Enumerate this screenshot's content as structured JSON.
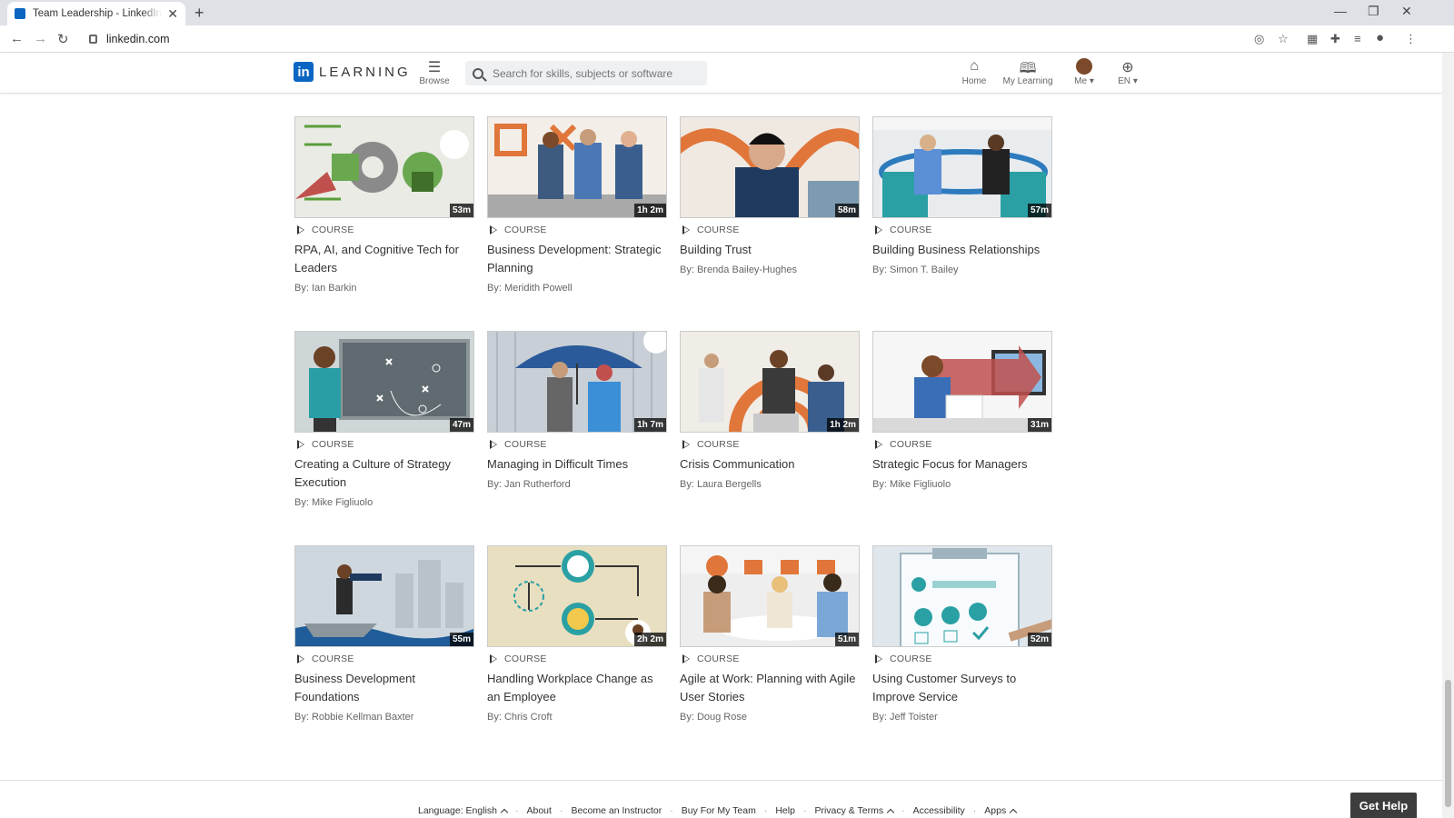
{
  "browser": {
    "tab_title": "Team Leadership - LinkedIn Learning",
    "url": "linkedin.com"
  },
  "header": {
    "logo_in": "in",
    "logo_word": "LEARNING",
    "browse": "Browse",
    "search_placeholder": "Search for skills, subjects or software",
    "nav": {
      "home": "Home",
      "my_learning": "My Learning",
      "me": "Me",
      "lang": "EN"
    }
  },
  "courses": [
    {
      "type": "COURSE",
      "title": "RPA, AI, and Cognitive Tech for Leaders",
      "author": "By: Ian Barkin",
      "duration": "53m"
    },
    {
      "type": "COURSE",
      "title": "Business Development: Strategic Planning",
      "author": "By: Meridith Powell",
      "duration": "1h 2m"
    },
    {
      "type": "COURSE",
      "title": "Building Trust",
      "author": "By: Brenda Bailey-Hughes",
      "duration": "58m"
    },
    {
      "type": "COURSE",
      "title": "Building Business Relationships",
      "author": "By: Simon T. Bailey",
      "duration": "57m"
    },
    {
      "type": "COURSE",
      "title": "Creating a Culture of Strategy Execution",
      "author": "By: Mike Figliuolo",
      "duration": "47m"
    },
    {
      "type": "COURSE",
      "title": "Managing in Difficult Times",
      "author": "By: Jan Rutherford",
      "duration": "1h 7m"
    },
    {
      "type": "COURSE",
      "title": "Crisis Communication",
      "author": "By: Laura Bergells",
      "duration": "1h 2m"
    },
    {
      "type": "COURSE",
      "title": "Strategic Focus for Managers",
      "author": "By: Mike Figliuolo",
      "duration": "31m"
    },
    {
      "type": "COURSE",
      "title": "Business Development Foundations",
      "author": "By: Robbie Kellman Baxter",
      "duration": "55m"
    },
    {
      "type": "COURSE",
      "title": "Handling Workplace Change as an Employee",
      "author": "By: Chris Croft",
      "duration": "2h 2m"
    },
    {
      "type": "COURSE",
      "title": "Agile at Work: Planning with Agile User Stories",
      "author": "By: Doug Rose",
      "duration": "51m"
    },
    {
      "type": "COURSE",
      "title": "Using Customer Surveys to Improve Service",
      "author": "By: Jeff Toister",
      "duration": "52m"
    }
  ],
  "footer": {
    "language": "Language: English",
    "about": "About",
    "instructor": "Become an Instructor",
    "buy": "Buy For My Team",
    "help": "Help",
    "privacy": "Privacy & Terms",
    "accessibility": "Accessibility",
    "apps": "Apps",
    "get_help": "Get Help"
  },
  "colors": {
    "linkedin_blue": "#0a66c2",
    "accent_orange": "#e1763a"
  }
}
